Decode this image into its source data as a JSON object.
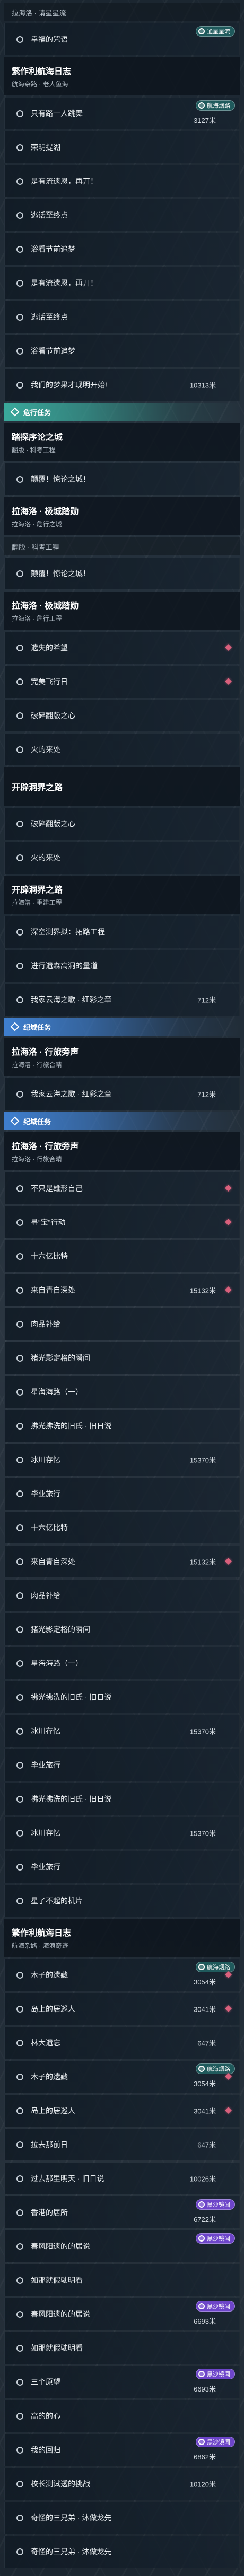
{
  "colors": {
    "category_teal": "#3aa89b",
    "category_blue": "#3f7fcf",
    "badge_teal": "#1f5a5c",
    "badge_purple": "#6d45c9",
    "marker": "#d9607c"
  },
  "log": {
    "entries": [
      {
        "type": "subtitle",
        "title": "拉海洛 · 请星星流"
      },
      {
        "type": "item",
        "title": "幸福的咒语",
        "badge": "通星星流",
        "badge_color": "#1f5a5c"
      },
      {
        "type": "header",
        "title": "繁作利航海日志",
        "subtitle": "航海杂路 · 老人鱼海"
      },
      {
        "type": "item",
        "title": "只有路一人跳舞",
        "distance": "3127米",
        "badge": "航海烟路",
        "badge_color": "#1f5a5c"
      },
      {
        "type": "item",
        "title": "荣明提湖"
      },
      {
        "type": "item",
        "title": "是有流遗恩，再开！"
      },
      {
        "type": "item",
        "title": "逃话至终点"
      },
      {
        "type": "item",
        "title": "浴看节前追梦"
      },
      {
        "type": "item",
        "title": "是有流遗恩，再开！"
      },
      {
        "type": "item",
        "title": "逃话至终点"
      },
      {
        "type": "item",
        "title": "浴看节前追梦"
      },
      {
        "type": "item",
        "title": "我们的梦果才现明开始!",
        "distance": "10313米"
      },
      {
        "type": "category",
        "title": "危行任务",
        "color": "#3aa89b"
      },
      {
        "type": "header",
        "title": "踏探序论之城",
        "subtitle": "翻版 · 科考工程"
      },
      {
        "type": "item",
        "title": "颠覆！惊论之城！"
      },
      {
        "type": "header",
        "title": "拉海洛 · 极城踏勋",
        "subtitle": "拉海洛 · 危行之城"
      },
      {
        "type": "subtitle",
        "title": "翻版 · 科考工程"
      },
      {
        "type": "item",
        "title": "颠覆！惊论之城！"
      },
      {
        "type": "header",
        "title": "拉海洛 · 极城踏勋",
        "subtitle": "拉海洛 · 危行工程"
      },
      {
        "type": "item",
        "title": "遗失的希望",
        "marker": true
      },
      {
        "type": "item",
        "title": "完美飞行日",
        "marker": true
      },
      {
        "type": "item",
        "title": "破碎翻版之心"
      },
      {
        "type": "item",
        "title": "火的来处"
      },
      {
        "type": "header",
        "title": "开辟洞界之路",
        "subtitle": ""
      },
      {
        "type": "item",
        "title": "破碎翻版之心"
      },
      {
        "type": "item",
        "title": "火的来处"
      },
      {
        "type": "header",
        "title": "开辟洞界之路",
        "subtitle": "拉海洛 · 重建工程"
      },
      {
        "type": "item",
        "title": "深空测界拟：拓路工程"
      },
      {
        "type": "item",
        "title": "进行遗森高洞的量道"
      },
      {
        "type": "item",
        "title": "我家云海之歌 · 红彩之章",
        "distance": "712米"
      },
      {
        "type": "category",
        "title": "纪域任务",
        "color": "#3f7fcf"
      },
      {
        "type": "header",
        "title": "拉海洛 · 行旅旁声",
        "subtitle": "拉海洛 · 行旅合晴"
      },
      {
        "type": "item",
        "title": "我家云海之歌 · 红彩之章",
        "distance": "712米"
      },
      {
        "type": "category",
        "title": "纪域任务",
        "color": "#3f7fcf"
      },
      {
        "type": "header",
        "title": "拉海洛 · 行旅旁声",
        "subtitle": "拉海洛 · 行旅合晴"
      },
      {
        "type": "item",
        "title": "不只是雄形自己",
        "marker": true
      },
      {
        "type": "item",
        "title": "寻“宝”行动",
        "marker": true
      },
      {
        "type": "item",
        "title": "十六亿比特"
      },
      {
        "type": "item",
        "title": "来自青自深处",
        "distance": "15132米",
        "marker": true
      },
      {
        "type": "item",
        "title": "肉品补给"
      },
      {
        "type": "item",
        "title": "猪光影定格的瞬间"
      },
      {
        "type": "item",
        "title": "星海海路（一）"
      },
      {
        "type": "item",
        "title": "拂光拂洗的旧氏 · 旧日说"
      },
      {
        "type": "item",
        "title": "冰川存忆",
        "distance": "15370米"
      },
      {
        "type": "item",
        "title": "毕业旅行"
      },
      {
        "type": "item",
        "title": "十六亿比特"
      },
      {
        "type": "item",
        "title": "来自青自深处",
        "distance": "15132米",
        "marker": true
      },
      {
        "type": "item",
        "title": "肉品补给"
      },
      {
        "type": "item",
        "title": "猪光影定格的瞬间"
      },
      {
        "type": "item",
        "title": "星海海路（一）"
      },
      {
        "type": "item",
        "title": "拂光拂洗的旧氏 · 旧日说"
      },
      {
        "type": "item",
        "title": "冰川存忆",
        "distance": "15370米"
      },
      {
        "type": "item",
        "title": "毕业旅行"
      },
      {
        "type": "item",
        "title": "拂光拂洗的旧氏 · 旧日说"
      },
      {
        "type": "item",
        "title": "冰川存忆",
        "distance": "15370米"
      },
      {
        "type": "item",
        "title": "毕业旅行"
      },
      {
        "type": "item",
        "title": "星了不起的机片"
      },
      {
        "type": "header",
        "title": "繁作利航海日志",
        "subtitle": "航海杂路 · 海浪奇迹"
      },
      {
        "type": "item",
        "title": "木子的遗藏",
        "distance": "3054米",
        "badge": "航海烟路",
        "badge_color": "#1f5a5c",
        "marker": true
      },
      {
        "type": "item",
        "title": "岛上的居巡人",
        "distance": "3041米",
        "marker": true
      },
      {
        "type": "item",
        "title": "林大遗忘",
        "distance": "647米"
      },
      {
        "type": "item",
        "title": "木子的遗藏",
        "distance": "3054米",
        "badge": "航海烟路",
        "badge_color": "#1f5a5c",
        "marker": true
      },
      {
        "type": "item",
        "title": "岛上的居巡人",
        "distance": "3041米",
        "marker": true
      },
      {
        "type": "item",
        "title": "拉去那前日",
        "distance": "647米"
      },
      {
        "type": "item",
        "title": "过去那里明天 · 旧日说",
        "distance": "10026米"
      },
      {
        "type": "item",
        "title": "香港的居所",
        "distance": "6722米",
        "badge": "黑沙镜闻",
        "badge_color": "#6d45c9"
      },
      {
        "type": "item",
        "title": "春风阳遗的的居说",
        "badge": "黑沙镜闻",
        "badge_color": "#6d45c9"
      },
      {
        "type": "item",
        "title": "如那就假驶明看"
      },
      {
        "type": "item",
        "title": "春风阳遗的的居说",
        "distance": "6693米",
        "badge": "黑沙镜闻",
        "badge_color": "#6d45c9"
      },
      {
        "type": "item",
        "title": "如那就假驶明看"
      },
      {
        "type": "item",
        "title": "三个原望",
        "distance": "6693米",
        "badge": "黑沙镜闻",
        "badge_color": "#6d45c9"
      },
      {
        "type": "item",
        "title": "高的的心"
      },
      {
        "type": "item",
        "title": "我的回归",
        "distance": "6862米",
        "badge": "黑沙镜闻",
        "badge_color": "#6d45c9"
      },
      {
        "type": "item",
        "title": "校长测试透的挑战",
        "distance": "10120米"
      },
      {
        "type": "item",
        "title": "奇怪的三兄弟 · 沐做龙先"
      },
      {
        "type": "item",
        "title": "奇怪的三兄弟 · 沐做龙先"
      }
    ]
  }
}
